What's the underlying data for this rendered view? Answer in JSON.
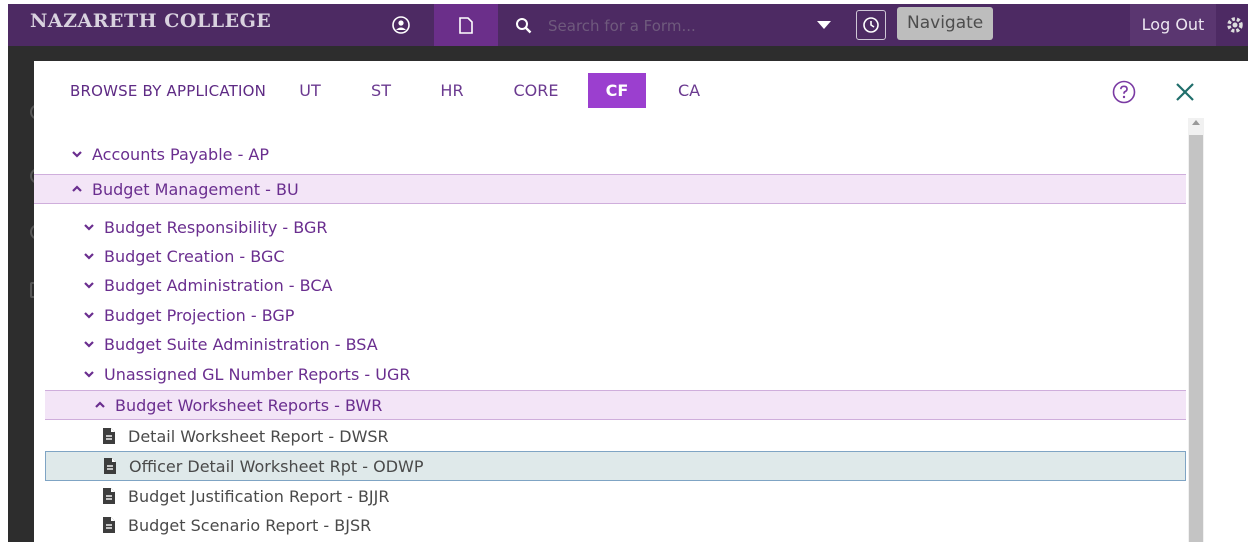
{
  "header": {
    "brand": "NAZARETH COLLEGE",
    "search_placeholder": "Search for a Form...",
    "navigate_label": "Navigate",
    "logout_label": "Log Out"
  },
  "browse": {
    "label": "BROWSE BY APPLICATION",
    "tabs": [
      {
        "label": "UT",
        "active": false
      },
      {
        "label": "ST",
        "active": false
      },
      {
        "label": "HR",
        "active": false
      },
      {
        "label": "CORE",
        "active": false
      },
      {
        "label": "CF",
        "active": true
      },
      {
        "label": "CA",
        "active": false
      }
    ]
  },
  "tree": {
    "items": [
      {
        "label": "Accounts Payable - AP",
        "kind": "collapsed",
        "level": 0
      },
      {
        "label": "Budget Management - BU",
        "kind": "expanded",
        "level": 0
      },
      {
        "label": "Budget Responsibility - BGR",
        "kind": "collapsed",
        "level": 1
      },
      {
        "label": "Budget Creation - BGC",
        "kind": "collapsed",
        "level": 1
      },
      {
        "label": "Budget Administration - BCA",
        "kind": "collapsed",
        "level": 1
      },
      {
        "label": "Budget Projection - BGP",
        "kind": "collapsed",
        "level": 1
      },
      {
        "label": "Budget Suite Administration - BSA",
        "kind": "collapsed",
        "level": 1
      },
      {
        "label": "Unassigned GL Number Reports - UGR",
        "kind": "collapsed",
        "level": 1
      },
      {
        "label": "Budget Worksheet Reports - BWR",
        "kind": "expanded",
        "level": 1
      },
      {
        "label": "Detail Worksheet Report - DWSR",
        "kind": "file",
        "level": 2
      },
      {
        "label": "Officer Detail Worksheet Rpt - ODWP",
        "kind": "file",
        "level": 2,
        "selected": true
      },
      {
        "label": "Budget Justification Report - BJJR",
        "kind": "file",
        "level": 2
      },
      {
        "label": "Budget Scenario Report - BJSR",
        "kind": "file",
        "level": 2
      }
    ]
  },
  "colors": {
    "topbar": "#4d2a63",
    "accent": "#9b3fcf",
    "link": "#6a2e8f",
    "expanded_row": "#f3e5f7",
    "selected_row": "#dfe9ea"
  }
}
